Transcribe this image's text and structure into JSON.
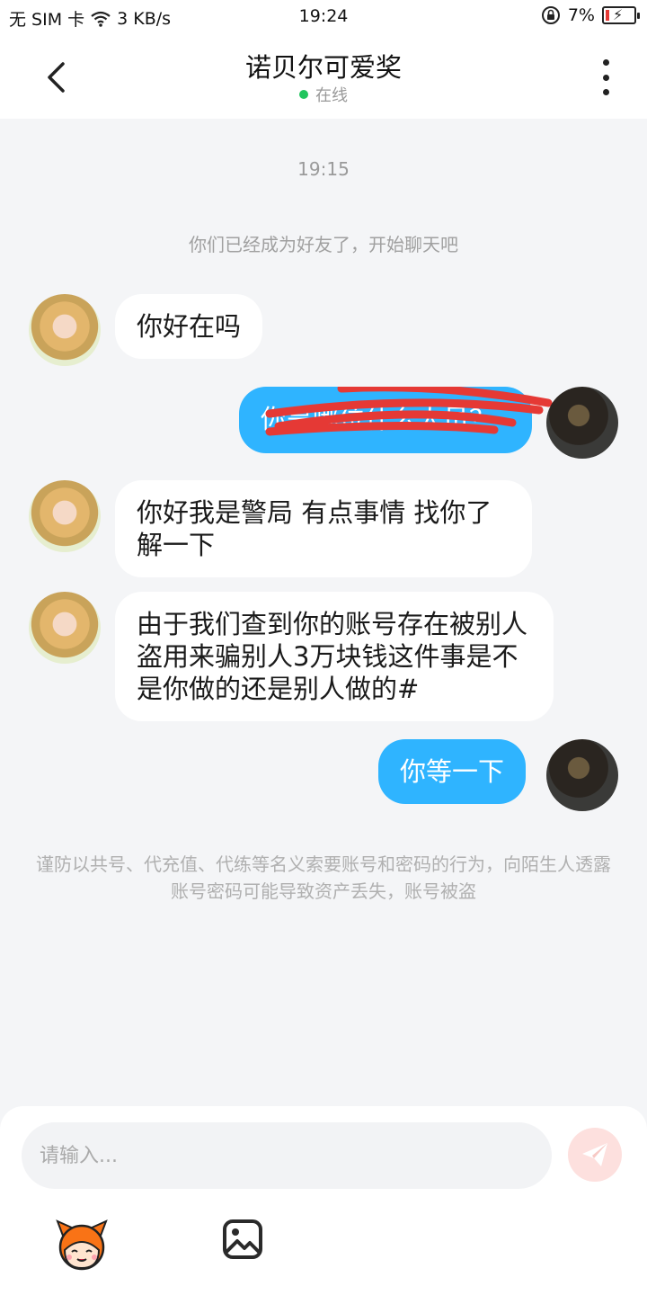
{
  "status_bar": {
    "carrier": "无 SIM 卡",
    "speed": "3 KB/s",
    "time": "19:24",
    "battery": "7%",
    "icons": [
      "wifi-icon",
      "lock-rotation-icon",
      "battery-icon"
    ]
  },
  "header": {
    "title": "诺贝尔可爱奖",
    "status": "在线",
    "icons": [
      "back-arrow-icon",
      "more-vertical-icon"
    ]
  },
  "chat": {
    "timestamp": "19:15",
    "system_note": "你们已经成为好友了，开始聊天吧",
    "messages": [
      {
        "from": "other",
        "text": "你好在吗"
      },
      {
        "from": "me",
        "text": "你是哪位什么人员？"
      },
      {
        "from": "other",
        "text": "你好我是警局 有点事情 找你了解一下"
      },
      {
        "from": "other",
        "text": "由于我们查到你的账号存在被别人盗用来骗别人3万块钱这件事是不是你做的还是别人做的#"
      },
      {
        "from": "me",
        "text": "你等一下"
      }
    ],
    "warning": "谨防以共号、代充值、代练等名义索要账号和密码的行为，向陌生人透露账号密码可能导致资产丢失，账号被盗"
  },
  "input": {
    "placeholder": "请输入...",
    "icons": [
      "send-icon",
      "emoji-sticker-icon",
      "image-icon"
    ]
  },
  "colors": {
    "accent": "#2fb4ff",
    "online": "#22c55e",
    "send_disabled": "#fde0de",
    "background": "#f4f5f7"
  }
}
